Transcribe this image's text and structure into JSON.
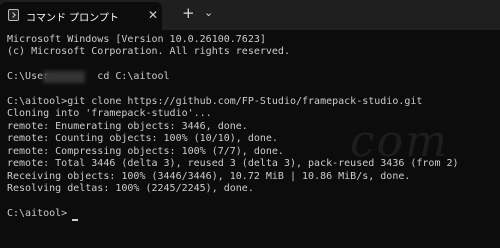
{
  "window": {
    "tab_title": "コマンド プロンプト",
    "tab_close_icon": "✕",
    "new_tab_icon": "+",
    "dropdown_icon": "⌄"
  },
  "console": {
    "lines": [
      "Microsoft Windows [Version 10.0.26100.7623]",
      "(c) Microsoft Corporation. All rights reserved.",
      "",
      "C:\\User        cd C:\\aitool",
      "",
      "C:\\aitool>git clone https://github.com/FP-Studio/framepack-studio.git",
      "Cloning into 'framepack-studio'...",
      "remote: Enumerating objects: 3446, done.",
      "remote: Counting objects: 100% (10/10), done.",
      "remote: Compressing objects: 100% (7/7), done.",
      "remote: Total 3446 (delta 3), reused 3 (delta 3), pack-reused 3436 (from 2)",
      "Receiving objects: 100% (3446/3446), 10.72 MiB | 10.86 MiB/s, done.",
      "Resolving deltas: 100% (2245/2245), done.",
      "",
      "C:\\aitool>"
    ]
  }
}
